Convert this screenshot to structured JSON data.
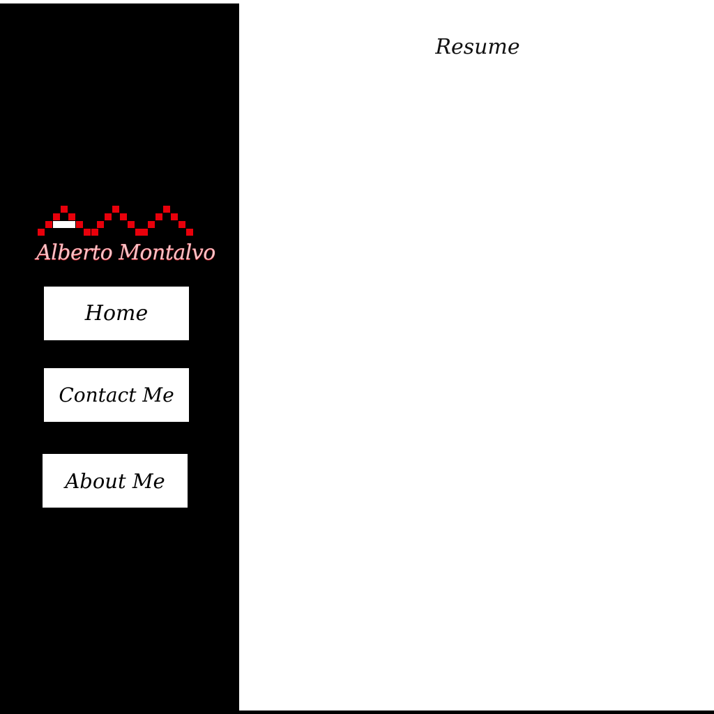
{
  "brand": {
    "name": "Alberto Montalvo",
    "logo_color": "#e8000b",
    "logo_highlight": "#ffffff"
  },
  "nav": {
    "home_label": "Home",
    "contact_label": "Contact Me",
    "about_label": "About Me"
  },
  "main": {
    "title": "Resume"
  },
  "colors": {
    "sidebar": "#000000",
    "content_bg": "#ffffff",
    "button_bg": "#ffffff",
    "button_text": "#000000"
  }
}
